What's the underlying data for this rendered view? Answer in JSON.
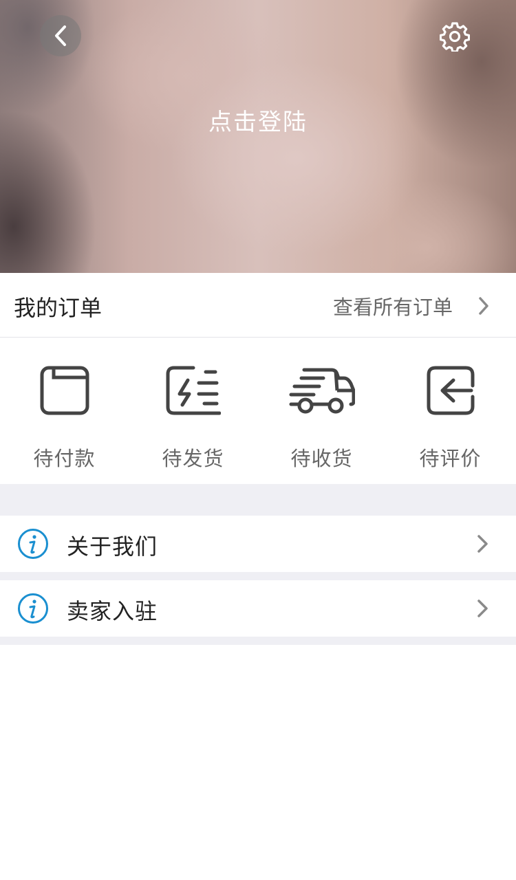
{
  "header": {
    "back_icon": "chevron-left-icon",
    "settings_icon": "gear-icon",
    "login_label": "点击登陆"
  },
  "orders": {
    "title": "我的订单",
    "view_all_label": "查看所有订单",
    "statuses": [
      {
        "label": "待付款",
        "icon": "wallet-icon"
      },
      {
        "label": "待发货",
        "icon": "shipment-icon"
      },
      {
        "label": "待收货",
        "icon": "delivery-truck-icon"
      },
      {
        "label": "待评价",
        "icon": "review-return-icon"
      }
    ]
  },
  "menu": {
    "items": [
      {
        "label": "关于我们",
        "icon": "info-icon"
      },
      {
        "label": "卖家入驻",
        "icon": "info-icon"
      }
    ]
  },
  "colors": {
    "icon_dark": "#444444",
    "info_blue": "#1a8fd0",
    "separator": "#efeff4",
    "chevron": "#8a8a8a"
  }
}
